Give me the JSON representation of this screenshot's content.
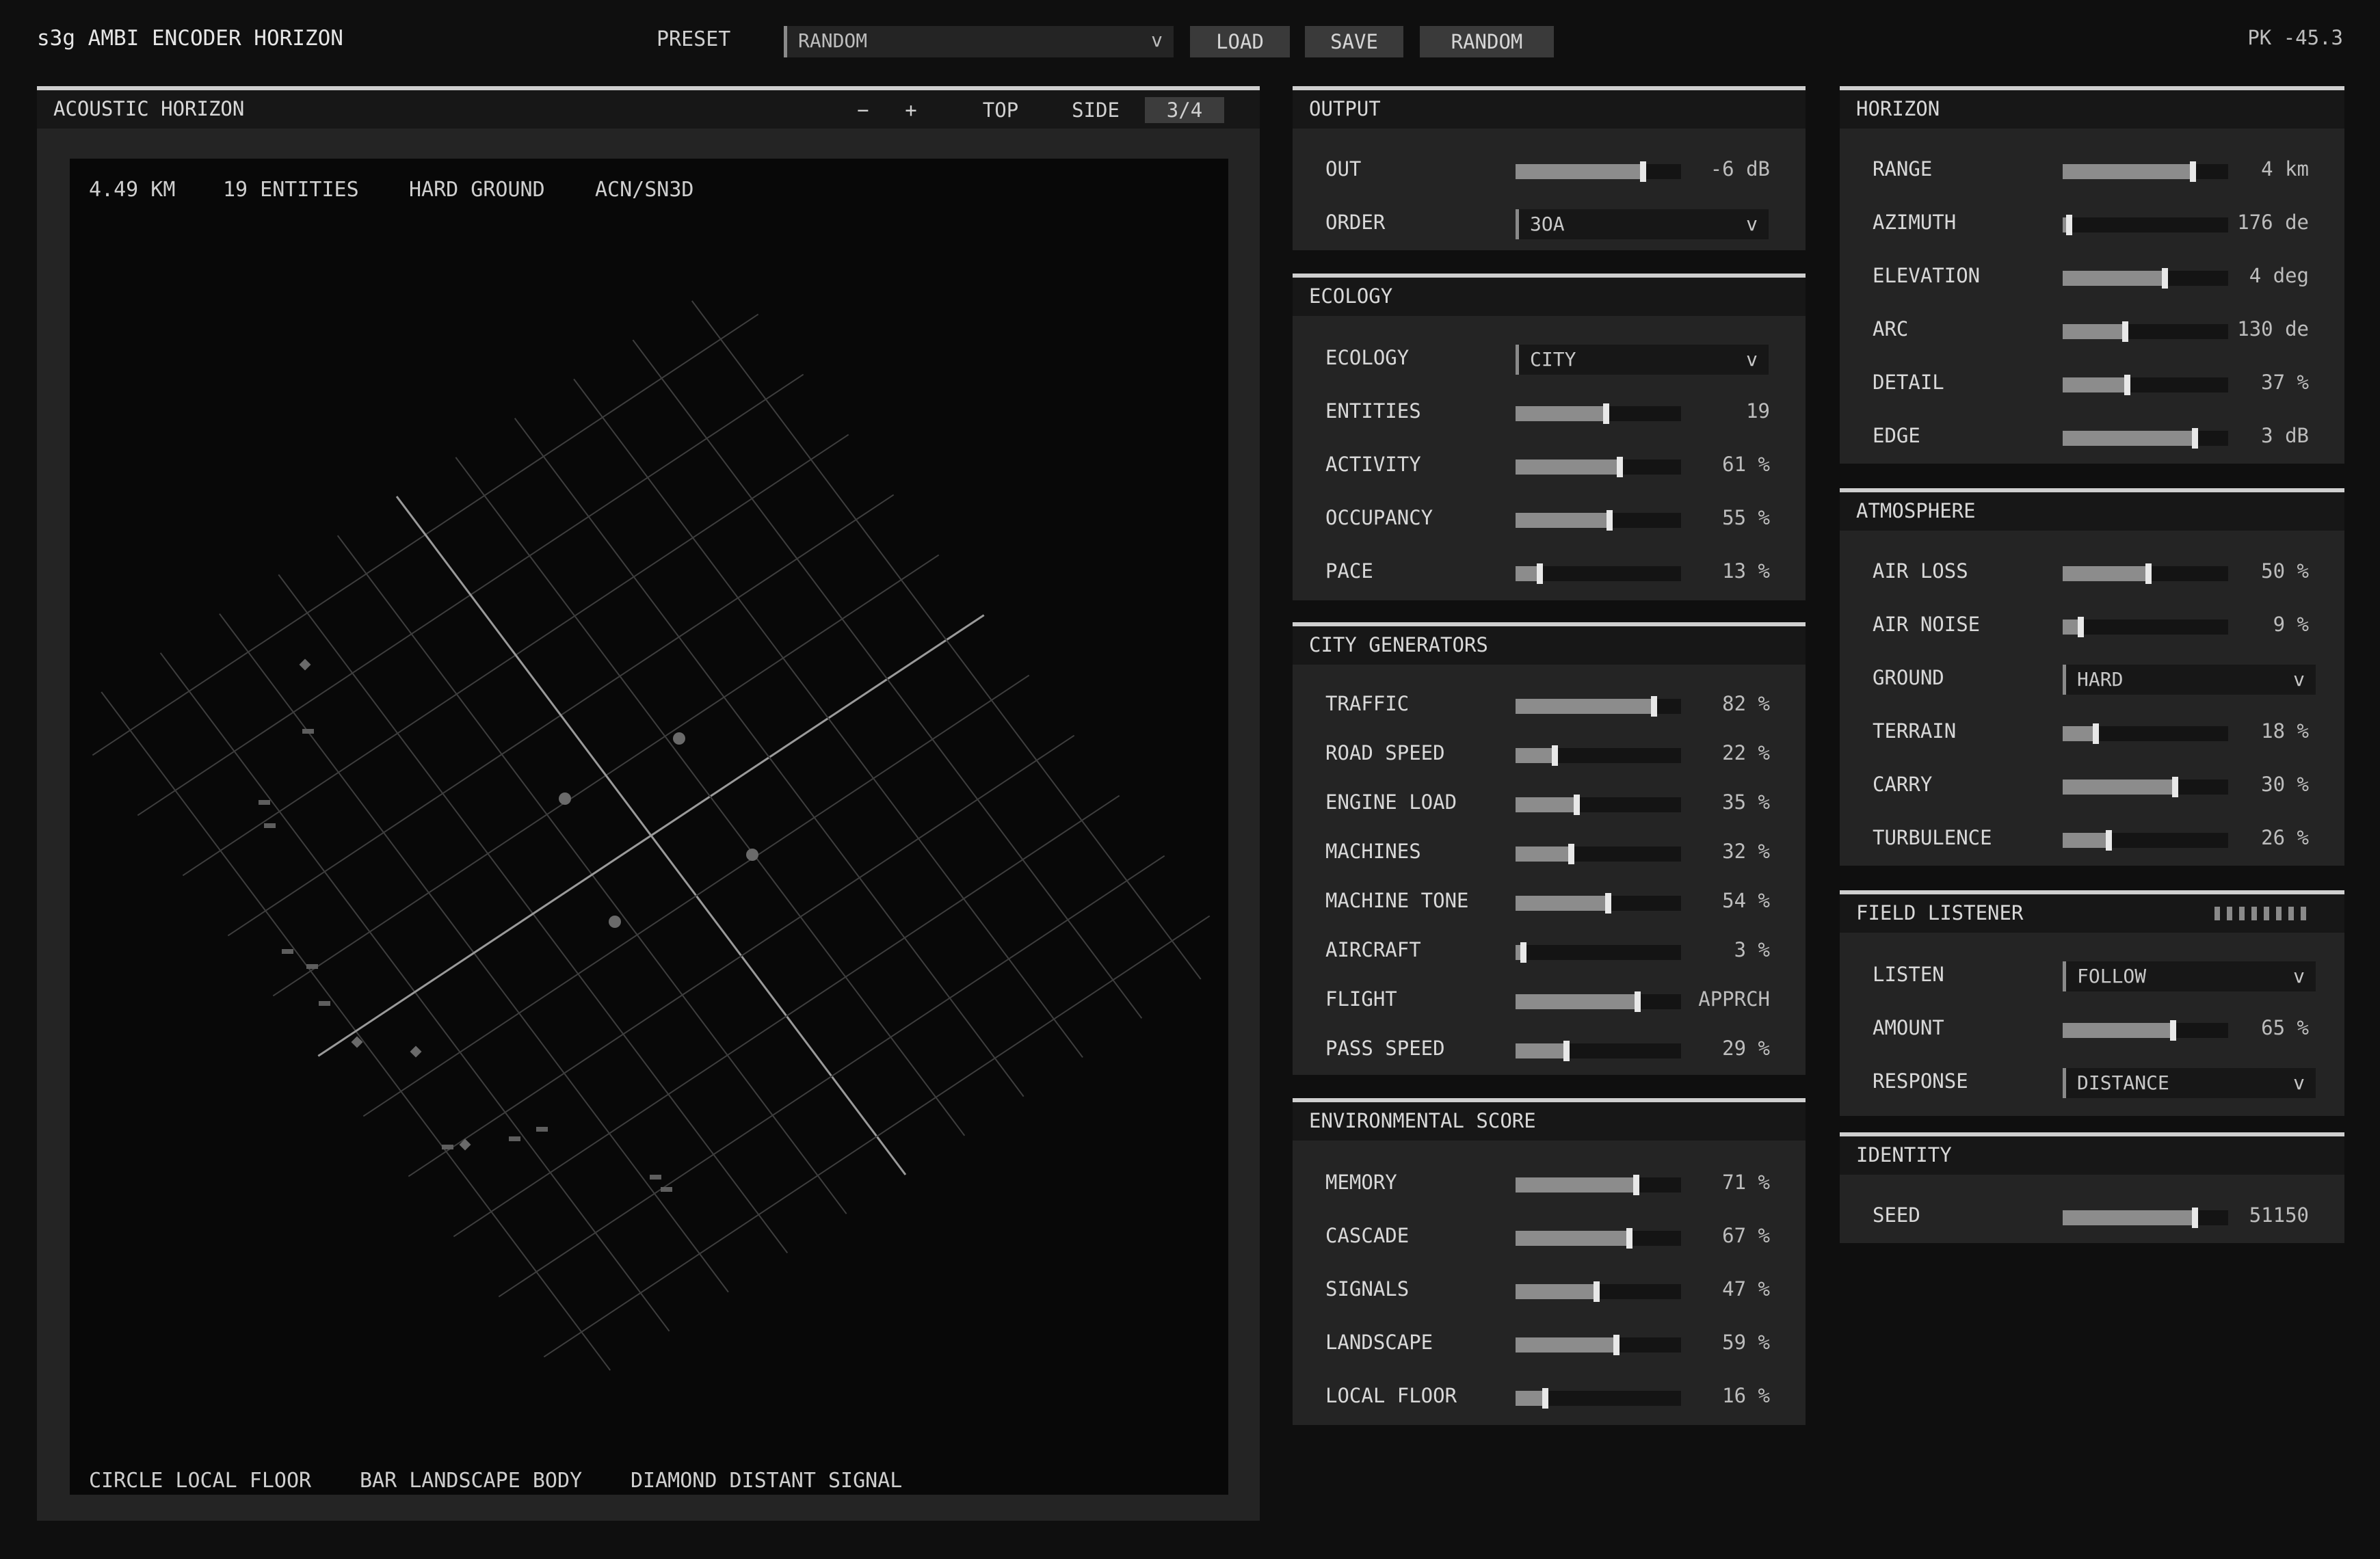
{
  "app": {
    "title": "s3g AMBI ENCODER HORIZON",
    "peak": "PK -45.3"
  },
  "toolbar": {
    "preset_label": "PRESET",
    "preset_value": "RANDOM",
    "chevron": "v",
    "load_label": "LOAD",
    "save_label": "SAVE",
    "random_label": "RANDOM"
  },
  "viewer": {
    "title": "ACOUSTIC HORIZON",
    "zoom_out": "−",
    "zoom_in": "+",
    "view_top": "TOP",
    "view_side": "SIDE",
    "view_34": "3/4",
    "info": [
      "4.49 KM",
      "19 ENTITIES",
      "HARD GROUND",
      "ACN/SN3D"
    ],
    "legend": [
      "CIRCLE LOCAL FLOOR",
      "BAR LANDSCAPE BODY",
      "DIAMOND DISTANT SIGNAL"
    ]
  },
  "output": {
    "title": "OUTPUT",
    "out": {
      "label": "OUT",
      "value": "-6 dB",
      "level": 0.75
    },
    "order": {
      "label": "ORDER",
      "value": "3OA"
    }
  },
  "ecology": {
    "title": "ECOLOGY",
    "ecology": {
      "label": "ECOLOGY",
      "value": "CITY"
    },
    "sliders": [
      {
        "label": "ENTITIES",
        "value": "19",
        "level": 0.53
      },
      {
        "label": "ACTIVITY",
        "value": "61 %",
        "level": 0.61
      },
      {
        "label": "OCCUPANCY",
        "value": "55 %",
        "level": 0.55
      },
      {
        "label": "PACE",
        "value": "13 %",
        "level": 0.13
      }
    ]
  },
  "city_generators": {
    "title": "CITY GENERATORS",
    "sliders": [
      {
        "label": "TRAFFIC",
        "value": "82 %",
        "level": 0.82
      },
      {
        "label": "ROAD SPEED",
        "value": "22 %",
        "level": 0.22
      },
      {
        "label": "ENGINE LOAD",
        "value": "35 %",
        "level": 0.35
      },
      {
        "label": "MACHINES",
        "value": "32 %",
        "level": 0.32
      },
      {
        "label": "MACHINE TONE",
        "value": "54 %",
        "level": 0.54
      },
      {
        "label": "AIRCRAFT",
        "value": "3 %",
        "level": 0.03
      },
      {
        "label": "FLIGHT",
        "value": "APPRCH",
        "level": 0.72
      },
      {
        "label": "PASS SPEED",
        "value": "29 %",
        "level": 0.29
      }
    ]
  },
  "environmental_score": {
    "title": "ENVIRONMENTAL SCORE",
    "sliders": [
      {
        "label": "MEMORY",
        "value": "71 %",
        "level": 0.71
      },
      {
        "label": "CASCADE",
        "value": "67 %",
        "level": 0.67
      },
      {
        "label": "SIGNALS",
        "value": "47 %",
        "level": 0.47
      },
      {
        "label": "LANDSCAPE",
        "value": "59 %",
        "level": 0.59
      },
      {
        "label": "LOCAL FLOOR",
        "value": "16 %",
        "level": 0.16
      }
    ]
  },
  "horizon": {
    "title": "HORIZON",
    "sliders": [
      {
        "label": "RANGE",
        "value": "4 km",
        "level": 0.77
      },
      {
        "label": "AZIMUTH",
        "value": "176 de",
        "level": 0.02
      },
      {
        "label": "ELEVATION",
        "value": "4 deg",
        "level": 0.6
      },
      {
        "label": "ARC",
        "value": "130 de",
        "level": 0.36
      },
      {
        "label": "DETAIL",
        "value": "37 %",
        "level": 0.37
      },
      {
        "label": "EDGE",
        "value": "3 dB",
        "level": 0.78
      }
    ]
  },
  "atmosphere": {
    "title": "ATMOSPHERE",
    "air_loss": {
      "label": "AIR LOSS",
      "value": "50 %",
      "level": 0.5
    },
    "air_noise": {
      "label": "AIR NOISE",
      "value": "9 %",
      "level": 0.09
    },
    "ground": {
      "label": "GROUND",
      "value": "HARD"
    },
    "terrain": {
      "label": "TERRAIN",
      "value": "18 %",
      "level": 0.18
    },
    "carry": {
      "label": "CARRY",
      "value": "30 %",
      "level": 0.66
    },
    "turbulence": {
      "label": "TURBULENCE",
      "value": "26 %",
      "level": 0.26
    }
  },
  "field_listener": {
    "title": "FIELD LISTENER",
    "listen": {
      "label": "LISTEN",
      "value": "FOLLOW"
    },
    "amount": {
      "label": "AMOUNT",
      "value": "65 %",
      "level": 0.65
    },
    "response": {
      "label": "RESPONSE",
      "value": "DISTANCE"
    }
  },
  "identity": {
    "title": "IDENTITY",
    "seed": {
      "label": "SEED",
      "value": "51150",
      "level": 0.78
    }
  },
  "colors": {
    "background": "#0f0f0f",
    "panel": "#242424",
    "accent": "#cfcfcf",
    "fill": "#8c8c8c"
  }
}
